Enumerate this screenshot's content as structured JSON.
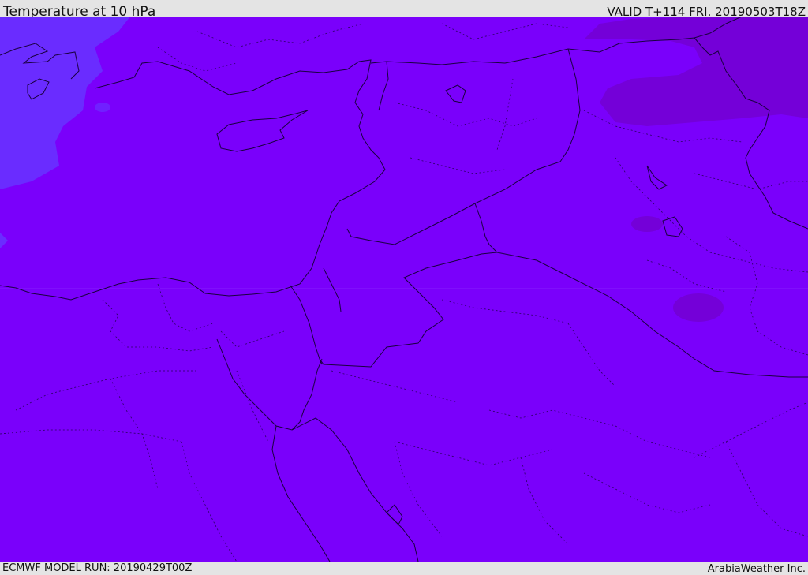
{
  "header": {
    "title": "Temperature at 10 hPa",
    "valid_time": "VALID T+114 FRI. 20190503T18Z"
  },
  "footer": {
    "model_run": "ECMWF MODEL RUN: 20190429T00Z",
    "credit": "ArabiaWeather Inc."
  },
  "map": {
    "field": "temperature",
    "level": "10 hPa",
    "colors": {
      "base_fill": "#7a00fb",
      "cold_fill": "#6a2cff",
      "warm_fill": "#7400d8",
      "border_line": "#1a0040"
    }
  }
}
